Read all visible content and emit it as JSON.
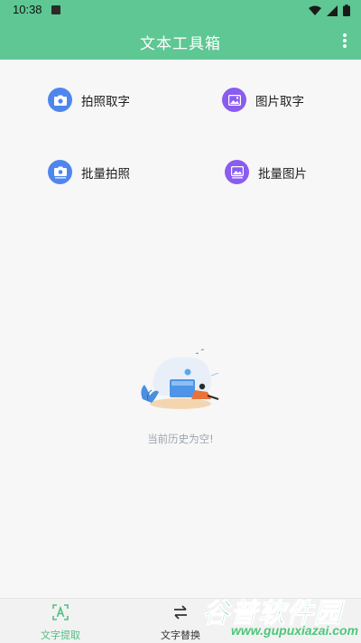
{
  "status_bar": {
    "time": "10:38"
  },
  "app_bar": {
    "title": "文本工具箱"
  },
  "features": [
    {
      "label": "拍照取字",
      "icon": "camera-icon",
      "color": "#4f86ee"
    },
    {
      "label": "图片取字",
      "icon": "image-icon",
      "color": "#8a5cf0"
    },
    {
      "label": "批量拍照",
      "icon": "camera-stack-icon",
      "color": "#4f86ee"
    },
    {
      "label": "批量图片",
      "icon": "image-stack-icon",
      "color": "#8a5cf0"
    }
  ],
  "empty_state": {
    "text": "当前历史为空!"
  },
  "bottom_nav": [
    {
      "label": "文字提取",
      "icon": "text-scan-icon",
      "active": true
    },
    {
      "label": "文字替换",
      "icon": "swap-icon",
      "active": false
    }
  ],
  "watermark": {
    "name": "谷普软件园",
    "url": "www.gupuxiazai.com"
  },
  "colors": {
    "primary": "#5ec793",
    "blue": "#4f86ee",
    "purple": "#8a5cf0",
    "active_tab": "#4fbf84"
  }
}
